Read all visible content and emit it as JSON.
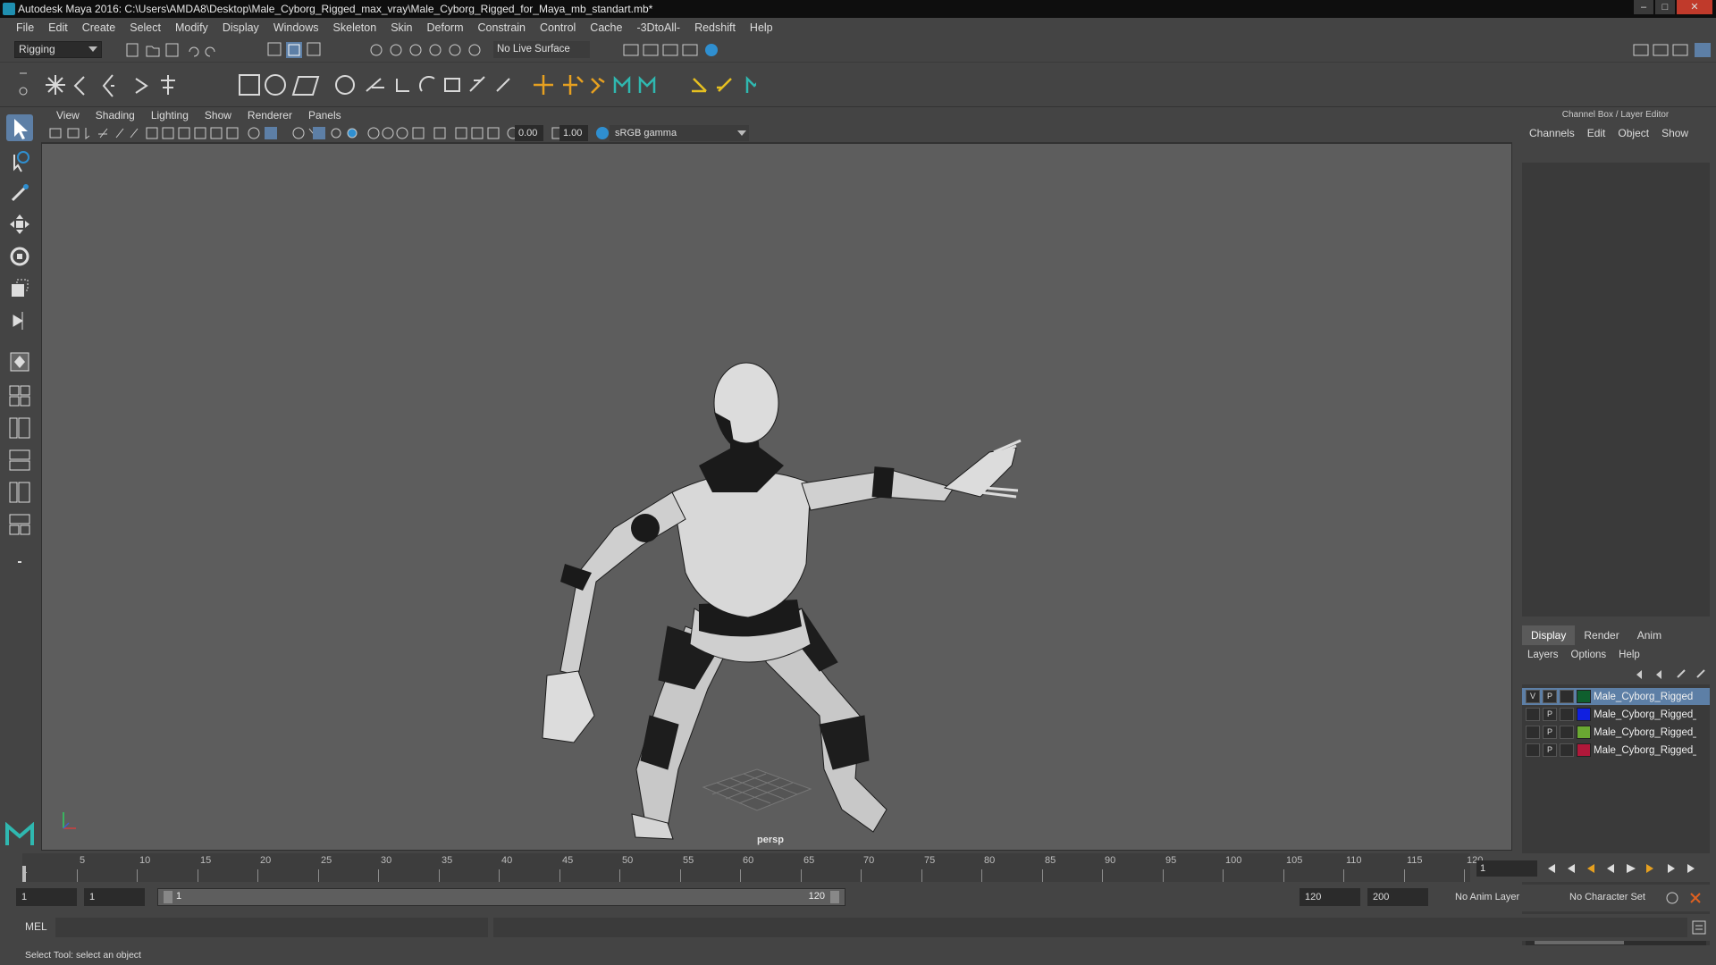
{
  "window": {
    "title": "Autodesk Maya 2016: C:\\Users\\AMDA8\\Desktop\\Male_Cyborg_Rigged_max_vray\\Male_Cyborg_Rigged_for_Maya_mb_standart.mb*",
    "minimize": "–",
    "maximize": "□",
    "close": "✕"
  },
  "menubar": [
    "File",
    "Edit",
    "Create",
    "Select",
    "Modify",
    "Display",
    "Windows",
    "Skeleton",
    "Skin",
    "Deform",
    "Constrain",
    "Control",
    "Cache",
    "-3DtoAll-",
    "Redshift",
    "Help"
  ],
  "statusline": {
    "mode": "Rigging",
    "live_surface": "No Live Surface"
  },
  "panel": {
    "menu": [
      "View",
      "Shading",
      "Lighting",
      "Show",
      "Renderer",
      "Panels"
    ],
    "near_value": "0.00",
    "far_value": "1.00",
    "color_space": "sRGB gamma",
    "camera": "persp"
  },
  "channel_box": {
    "header": "Channel Box / Layer Editor",
    "menu": [
      "Channels",
      "Edit",
      "Object",
      "Show"
    ]
  },
  "layer_editor": {
    "tabs": [
      "Display",
      "Render",
      "Anim"
    ],
    "active_tab": "Display",
    "menu": [
      "Layers",
      "Options",
      "Help"
    ],
    "layers": [
      {
        "v": "V",
        "p": "P",
        "name": "Male_Cyborg_Rigged",
        "color": "#0f5f2e",
        "selected": true
      },
      {
        "v": "",
        "p": "P",
        "name": "Male_Cyborg_Rigged_",
        "color": "#1020e0",
        "selected": false
      },
      {
        "v": "",
        "p": "P",
        "name": "Male_Cyborg_Rigged_",
        "color": "#6aa832",
        "selected": false
      },
      {
        "v": "",
        "p": "P",
        "name": "Male_Cyborg_Rigged_",
        "color": "#b0183a",
        "selected": false
      }
    ]
  },
  "timeline": {
    "ticks": [
      "5",
      "10",
      "15",
      "20",
      "25",
      "30",
      "35",
      "40",
      "45",
      "50",
      "55",
      "60",
      "65",
      "70",
      "75",
      "80",
      "85",
      "90",
      "95",
      "100",
      "105",
      "110",
      "115",
      "120"
    ],
    "start_marker": "1",
    "current_frame": "1"
  },
  "range": {
    "start": "1",
    "playback_start": "1",
    "slider_start": "1",
    "slider_end": "120",
    "playback_end": "120",
    "end": "200",
    "anim_layer": "No Anim Layer",
    "character_set": "No Character Set"
  },
  "command": {
    "language": "MEL"
  },
  "status": {
    "help_line": "Select Tool: select an object"
  },
  "colors": {
    "background": "#444444",
    "viewport": "#5d5d5d",
    "selection": "#5d7fa6"
  }
}
